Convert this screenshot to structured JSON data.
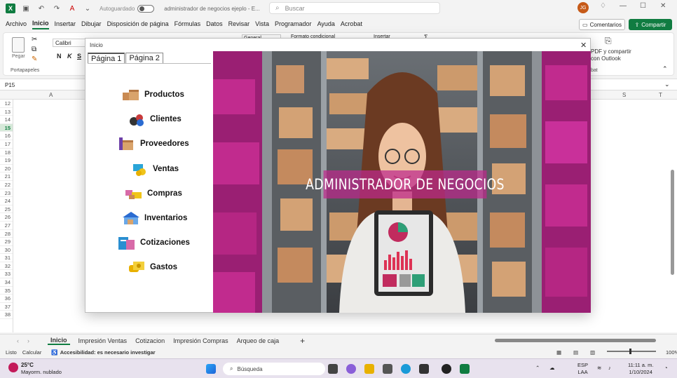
{
  "titlebar": {
    "autosave_label": "Autoguardado",
    "document_title": "administrador de negocios ejeplo - E...",
    "search_placeholder": "Buscar",
    "user_initials": "JG"
  },
  "ribbon": {
    "tabs": [
      "Archivo",
      "Inicio",
      "Insertar",
      "Dibujar",
      "Disposición de página",
      "Fórmulas",
      "Datos",
      "Revisar",
      "Vista",
      "Programador",
      "Ayuda",
      "Acrobat"
    ],
    "active_tab": "Inicio",
    "comments_button": "Comentarios",
    "share_button": "Compartir",
    "paste_label": "Pegar",
    "clipboard_group": "Portapapeles",
    "font_name": "Calibri",
    "bold": "N",
    "italic": "K",
    "underline": "S",
    "number_format": "General",
    "conditional_format": "Formato condicional",
    "insert_label": "Insertar",
    "pdf_share_line1": "PDF y compartir",
    "pdf_share_line2": "con Outlook",
    "acrobat_group": "bat"
  },
  "formula_bar": {
    "name_box": "P15"
  },
  "grid": {
    "col_headers_visible": [
      "A",
      "S",
      "T"
    ],
    "rows": [
      "12",
      "13",
      "14",
      "15",
      "16",
      "17",
      "18",
      "19",
      "20",
      "21",
      "22",
      "23",
      "24",
      "25",
      "26",
      "27",
      "28",
      "29",
      "30",
      "31",
      "32",
      "33",
      "34",
      "35",
      "36",
      "37",
      "38"
    ],
    "selected_row": "15"
  },
  "sheet_tabs": {
    "tabs": [
      "Inicio",
      "Impresión Ventas",
      "Cotizacion",
      "Impresión Compras",
      "Arqueo de caja"
    ],
    "active": "Inicio"
  },
  "statusbar": {
    "ready": "Listo",
    "calc": "Calcular",
    "accessibility": "Accesibilidad: es necesario investigar",
    "zoom": "100%"
  },
  "taskbar": {
    "temperature": "25°C",
    "weather": "Mayorm. nublado",
    "search": "Búsqueda",
    "lang1": "ESP",
    "lang2": "LAA",
    "time": "11:11 a. m.",
    "date": "1/10/2024"
  },
  "dialog": {
    "title": "Inicio",
    "close": "✕",
    "tabs": [
      "Página 1",
      "Página 2"
    ],
    "active_tab": "Página 1",
    "menu": [
      {
        "label": "Productos",
        "icon": "boxes-icon"
      },
      {
        "label": "Clientes",
        "icon": "people-icon"
      },
      {
        "label": "Proveedores",
        "icon": "delivery-icon"
      },
      {
        "label": "Ventas",
        "icon": "sales-icon"
      },
      {
        "label": "Compras",
        "icon": "shopping-icon"
      },
      {
        "label": "Inventarios",
        "icon": "warehouse-icon"
      },
      {
        "label": "Cotizaciones",
        "icon": "quote-icon"
      },
      {
        "label": "Gastos",
        "icon": "money-hand-icon"
      }
    ],
    "hero_title": "ADMINISTRADOR DE NEGOCIOS",
    "colors": {
      "accent": "#b5267f",
      "excel_green": "#107c41"
    }
  }
}
